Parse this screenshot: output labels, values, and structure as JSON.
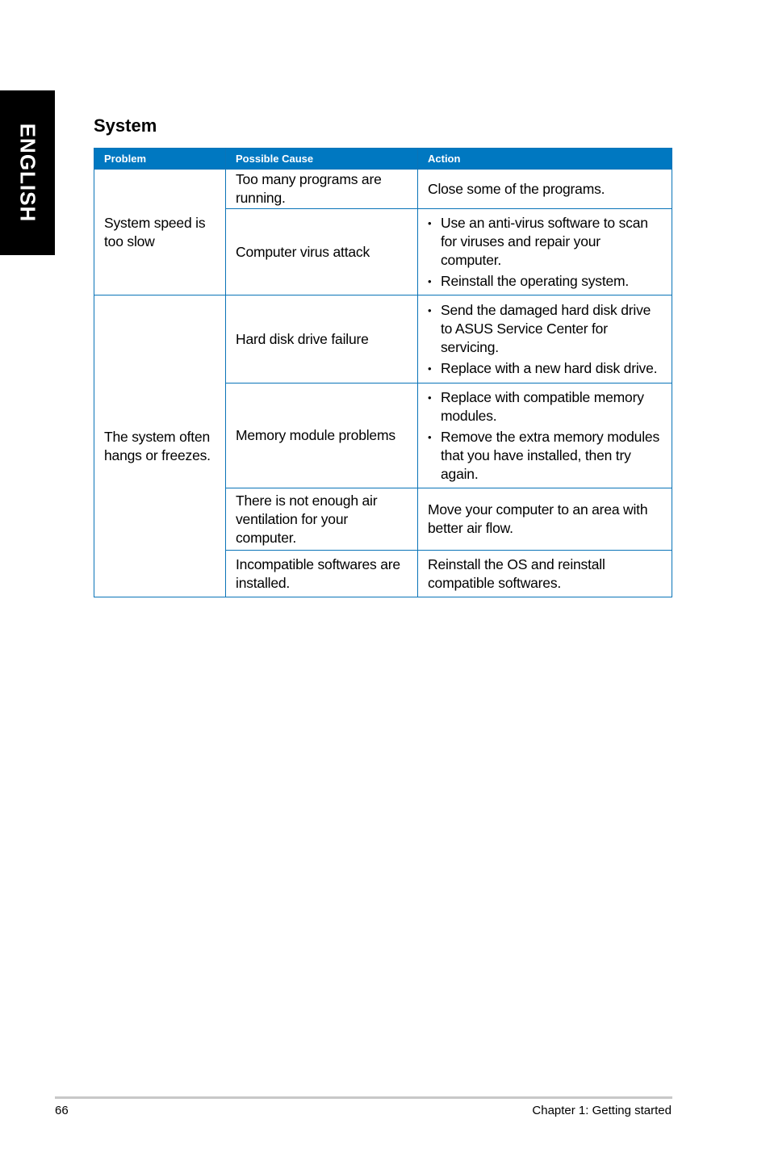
{
  "sidebar_tab": {
    "label": "ENGLISH"
  },
  "section": {
    "title": "System"
  },
  "table": {
    "headers": [
      "Problem",
      "Possible Cause",
      "Action"
    ],
    "problems": [
      {
        "problem": "System speed is too slow",
        "causes": [
          {
            "cause": "Too many programs are running.",
            "actions": [
              "Close some of the programs."
            ],
            "bulleted": false
          },
          {
            "cause": "Computer virus attack",
            "actions": [
              "Use an anti-virus software to scan for viruses and repair your computer.",
              "Reinstall the operating system."
            ],
            "bulleted": true
          }
        ]
      },
      {
        "problem": "The system often hangs or freezes.",
        "causes": [
          {
            "cause": "Hard disk drive failure",
            "actions": [
              "Send the damaged hard disk drive to ASUS Service Center for servicing.",
              "Replace with a new hard disk drive."
            ],
            "bulleted": true
          },
          {
            "cause": "Memory module problems",
            "actions": [
              "Replace with compatible memory modules.",
              "Remove the extra memory modules that you have installed, then try again."
            ],
            "bulleted": true
          },
          {
            "cause": "There is not enough air ventilation for your computer.",
            "actions": [
              "Move your computer to an area with better air flow."
            ],
            "bulleted": false
          },
          {
            "cause": "Incompatible softwares are installed.",
            "actions": [
              "Reinstall the OS and reinstall compatible softwares."
            ],
            "bulleted": false
          }
        ]
      }
    ]
  },
  "footer": {
    "page_number": "66",
    "chapter": "Chapter 1: Getting started"
  },
  "colors": {
    "header_blue": "#0078c1",
    "tab_black": "#000000"
  }
}
